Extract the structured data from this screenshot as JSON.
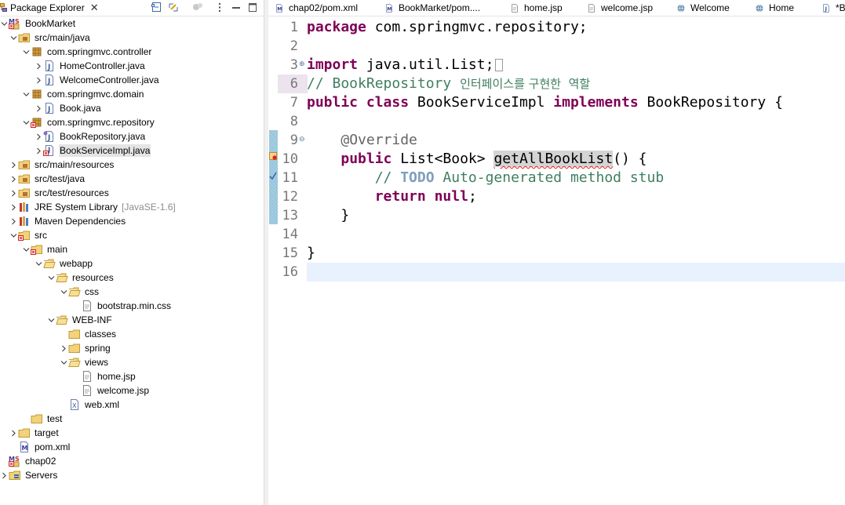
{
  "explorer": {
    "title": "Package Explorer",
    "close": "✕",
    "tree": [
      {
        "label": "BookMarket",
        "depth": 0,
        "twisty": "down",
        "icon": "maven-project-icon"
      },
      {
        "label": "src/main/java",
        "depth": 1,
        "twisty": "down",
        "icon": "source-folder-icon"
      },
      {
        "label": "com.springmvc.controller",
        "depth": 2,
        "twisty": "down",
        "icon": "package-icon"
      },
      {
        "label": "HomeController.java",
        "depth": 3,
        "twisty": "right",
        "icon": "java-file-icon"
      },
      {
        "label": "WelcomeController.java",
        "depth": 3,
        "twisty": "right",
        "icon": "java-file-icon"
      },
      {
        "label": "com.springmvc.domain",
        "depth": 2,
        "twisty": "down",
        "icon": "package-icon"
      },
      {
        "label": "Book.java",
        "depth": 3,
        "twisty": "right",
        "icon": "java-file-icon"
      },
      {
        "label": "com.springmvc.repository",
        "depth": 2,
        "twisty": "down",
        "icon": "package-error-icon"
      },
      {
        "label": "BookRepository.java",
        "depth": 3,
        "twisty": "right",
        "icon": "java-interface-file-icon"
      },
      {
        "label": "BookServiceImpl.java",
        "depth": 3,
        "twisty": "right",
        "icon": "java-error-file-icon",
        "selected": true
      },
      {
        "label": "src/main/resources",
        "depth": 1,
        "twisty": "right",
        "icon": "source-folder-icon"
      },
      {
        "label": "src/test/java",
        "depth": 1,
        "twisty": "right",
        "icon": "source-folder-icon"
      },
      {
        "label": "src/test/resources",
        "depth": 1,
        "twisty": "right",
        "icon": "source-folder-icon"
      },
      {
        "label": "JRE System Library",
        "decoration": "[JavaSE-1.6]",
        "depth": 1,
        "twisty": "right",
        "icon": "library-icon"
      },
      {
        "label": "Maven Dependencies",
        "depth": 1,
        "twisty": "right",
        "icon": "library-icon"
      },
      {
        "label": "src",
        "depth": 1,
        "twisty": "down",
        "icon": "folder-error-icon"
      },
      {
        "label": "main",
        "depth": 2,
        "twisty": "down",
        "icon": "folder-error-icon"
      },
      {
        "label": "webapp",
        "depth": 3,
        "twisty": "down",
        "icon": "open-folder-icon"
      },
      {
        "label": "resources",
        "depth": 4,
        "twisty": "down",
        "icon": "open-folder-icon"
      },
      {
        "label": "css",
        "depth": 5,
        "twisty": "down",
        "icon": "open-folder-icon"
      },
      {
        "label": "bootstrap.min.css",
        "depth": 6,
        "twisty": "none",
        "icon": "file-icon"
      },
      {
        "label": "WEB-INF",
        "depth": 4,
        "twisty": "down",
        "icon": "open-folder-icon"
      },
      {
        "label": "classes",
        "depth": 5,
        "twisty": "none",
        "icon": "folder-icon"
      },
      {
        "label": "spring",
        "depth": 5,
        "twisty": "right",
        "icon": "folder-icon"
      },
      {
        "label": "views",
        "depth": 5,
        "twisty": "down",
        "icon": "open-folder-icon"
      },
      {
        "label": "home.jsp",
        "depth": 6,
        "twisty": "none",
        "icon": "file-icon"
      },
      {
        "label": "welcome.jsp",
        "depth": 6,
        "twisty": "none",
        "icon": "file-icon"
      },
      {
        "label": "web.xml",
        "depth": 5,
        "twisty": "none",
        "icon": "xml-file-icon"
      },
      {
        "label": "test",
        "depth": 2,
        "twisty": "none",
        "icon": "folder-icon"
      },
      {
        "label": "target",
        "depth": 1,
        "twisty": "right",
        "icon": "folder-icon"
      },
      {
        "label": "pom.xml",
        "depth": 1,
        "twisty": "none",
        "icon": "maven-file-icon"
      },
      {
        "label": "chap02",
        "depth": 0,
        "twisty": "none",
        "icon": "maven-project-icon"
      },
      {
        "label": "Servers",
        "depth": 0,
        "twisty": "right",
        "icon": "servers-folder-icon"
      }
    ]
  },
  "editor_tabs": [
    {
      "label": "chap02/pom.xml",
      "icon": "maven-file-icon"
    },
    {
      "label": "BookMarket/pom....",
      "icon": "maven-file-icon"
    },
    {
      "label": "home.jsp",
      "icon": "file-icon"
    },
    {
      "label": "welcome.jsp",
      "icon": "file-icon"
    },
    {
      "label": "Welcome",
      "icon": "globe-icon"
    },
    {
      "label": "Home",
      "icon": "globe-icon"
    },
    {
      "label": "*Bo",
      "icon": "java-file-icon"
    }
  ],
  "code": {
    "line_numbers": [
      "1",
      "2",
      "3",
      "6",
      "7",
      "8",
      "9",
      "10",
      "11",
      "12",
      "13",
      "14",
      "15",
      "16"
    ],
    "lines": [
      [
        {
          "t": "package",
          "c": "kw"
        },
        {
          "t": " com.springmvc.repository;"
        }
      ],
      [],
      [
        {
          "t": "import",
          "c": "kw"
        },
        {
          "t": " java.util.List;"
        },
        {
          "t": "",
          "c": "fold-box"
        }
      ],
      [
        {
          "t": "// BookRepository ",
          "c": "cm"
        },
        {
          "t": "인터페이스를 구현한  역할",
          "c": "kr"
        }
      ],
      [
        {
          "t": "public",
          "c": "kw"
        },
        {
          "t": " "
        },
        {
          "t": "class",
          "c": "kw"
        },
        {
          "t": " BookServiceImpl "
        },
        {
          "t": "implements",
          "c": "kw"
        },
        {
          "t": " BookRepository {"
        }
      ],
      [],
      [
        {
          "t": "    "
        },
        {
          "t": "@Override",
          "c": "ann"
        }
      ],
      [
        {
          "t": "    "
        },
        {
          "t": "public",
          "c": "kw"
        },
        {
          "t": " List<Book> "
        },
        {
          "t": "getAllBookList",
          "c": "occ squig"
        },
        {
          "t": "() {"
        }
      ],
      [
        {
          "t": "        "
        },
        {
          "t": "// ",
          "c": "cm"
        },
        {
          "t": "TODO",
          "c": "todo"
        },
        {
          "t": " Auto-generated method stub",
          "c": "cm"
        }
      ],
      [
        {
          "t": "        "
        },
        {
          "t": "return",
          "c": "kw"
        },
        {
          "t": " "
        },
        {
          "t": "null",
          "c": "kw"
        },
        {
          "t": ";"
        }
      ],
      [
        {
          "t": "    }"
        }
      ],
      [],
      [
        {
          "t": "}"
        }
      ],
      []
    ]
  }
}
